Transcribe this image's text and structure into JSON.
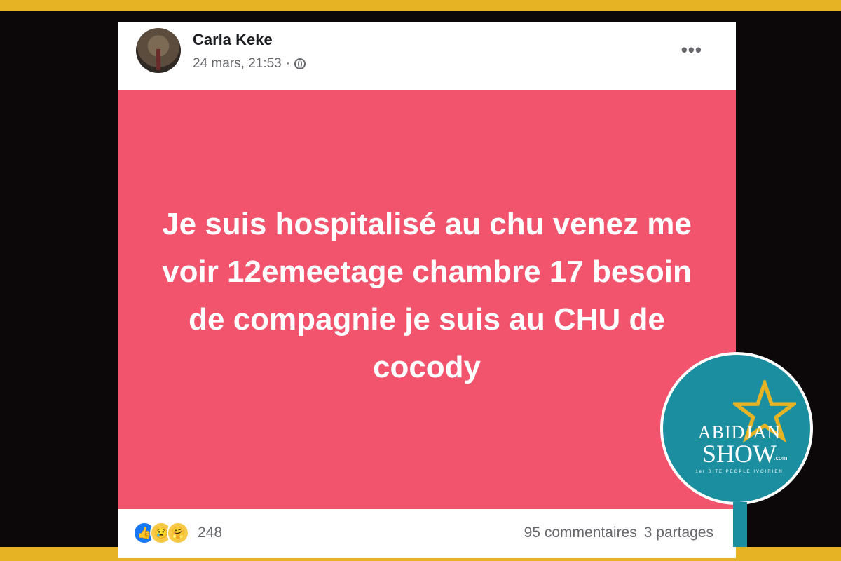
{
  "post": {
    "author": "Carla Keke",
    "date": "24 mars, 21:53",
    "separator": "·",
    "more_label": "•••",
    "status_text": "Je suis hospitalisé au chu venez me voir 12emeetage chambre 17 besoin de compagnie je suis au CHU de cocody",
    "status_bg": "#f2546e",
    "reactions": {
      "icons": [
        "like-icon",
        "sad-icon",
        "care-icon"
      ],
      "count": "248"
    },
    "comments": "95 commentaires",
    "shares": "3 partages"
  },
  "watermark": {
    "line1": "ABIDJAN",
    "line2": "SHOW",
    "suffix": ".com",
    "tagline": "1er SITE PEOPLE IVOIRIEN",
    "color": "#1b8fa0"
  },
  "frame_color": "#e6b325"
}
